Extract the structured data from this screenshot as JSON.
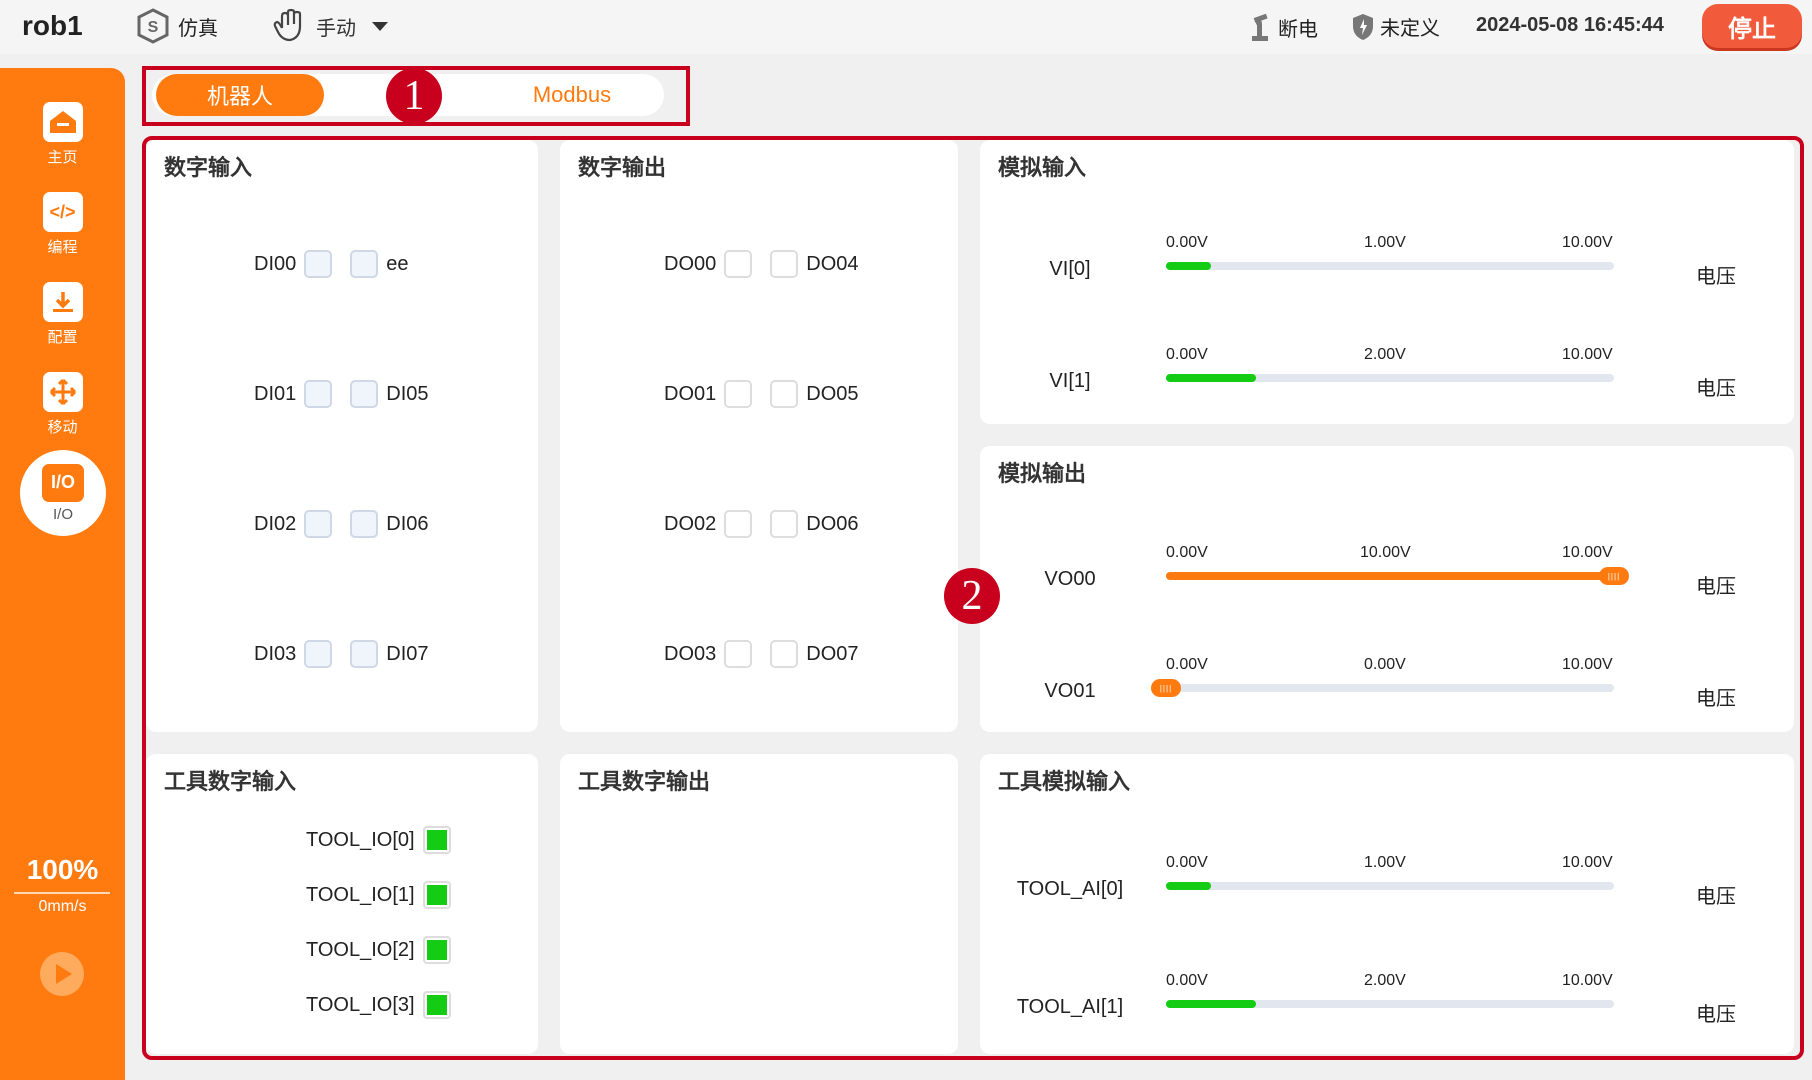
{
  "header": {
    "robot_name": "rob1",
    "sim_label": "仿真",
    "manual_label": "手动",
    "power_label": "断电",
    "safety_label": "未定义",
    "datetime": "2024-05-08 16:45:44",
    "stop_label": "停止"
  },
  "sidebar": {
    "items": [
      {
        "label": "主页",
        "icon": "home-icon"
      },
      {
        "label": "编程",
        "icon": "code-icon"
      },
      {
        "label": "配置",
        "icon": "download-icon"
      },
      {
        "label": "移动",
        "icon": "move-icon"
      }
    ],
    "active": {
      "label": "I/O",
      "icon_text": "I/O"
    },
    "speed": "100%",
    "speed_unit": "0mm/s",
    "help": [
      "?",
      "?",
      "?",
      "?"
    ]
  },
  "tabs": [
    {
      "label": "机器人",
      "active": true
    },
    {
      "label": "耶",
      "active": false
    },
    {
      "label": "Modbus",
      "active": false
    }
  ],
  "markers": [
    "1",
    "2"
  ],
  "digital_input": {
    "title": "数字输入",
    "rows": [
      {
        "left": "DI00",
        "right": "ee"
      },
      {
        "left": "DI01",
        "right": "DI05"
      },
      {
        "left": "DI02",
        "right": "DI06"
      },
      {
        "left": "DI03",
        "right": "DI07"
      }
    ]
  },
  "digital_output": {
    "title": "数字输出",
    "rows": [
      {
        "left": "DO00",
        "right": "DO04"
      },
      {
        "left": "DO01",
        "right": "DO05"
      },
      {
        "left": "DO02",
        "right": "DO06"
      },
      {
        "left": "DO03",
        "right": "DO07"
      }
    ]
  },
  "analog_input": {
    "title": "模拟输入",
    "rows": [
      {
        "name": "VI[0]",
        "min": "0.00V",
        "value": "1.00V",
        "max": "10.00V",
        "fraction": 0.1,
        "unit": "电压"
      },
      {
        "name": "VI[1]",
        "min": "0.00V",
        "value": "2.00V",
        "max": "10.00V",
        "fraction": 0.2,
        "unit": "电压"
      }
    ]
  },
  "analog_output": {
    "title": "模拟输出",
    "rows": [
      {
        "name": "VO00",
        "min": "0.00V",
        "value": "10.00V",
        "max": "10.00V",
        "fraction": 1.0,
        "unit": "电压"
      },
      {
        "name": "VO01",
        "min": "0.00V",
        "value": "0.00V",
        "max": "10.00V",
        "fraction": 0.0,
        "unit": "电压"
      }
    ]
  },
  "tool_digital_input": {
    "title": "工具数字输入",
    "rows": [
      "TOOL_IO[0]",
      "TOOL_IO[1]",
      "TOOL_IO[2]",
      "TOOL_IO[3]"
    ]
  },
  "tool_digital_output": {
    "title": "工具数字输出"
  },
  "tool_analog_input": {
    "title": "工具模拟输入",
    "rows": [
      {
        "name": "TOOL_AI[0]",
        "min": "0.00V",
        "value": "1.00V",
        "max": "10.00V",
        "fraction": 0.1,
        "unit": "电压"
      },
      {
        "name": "TOOL_AI[1]",
        "min": "0.00V",
        "value": "2.00V",
        "max": "10.00V",
        "fraction": 0.2,
        "unit": "电压"
      }
    ]
  },
  "colors": {
    "accent": "#ff7a0f",
    "stop": "#f15a3a",
    "annotation": "#c8001e",
    "input_fill": "#13cc13",
    "output_fill": "#ff7a0f"
  }
}
